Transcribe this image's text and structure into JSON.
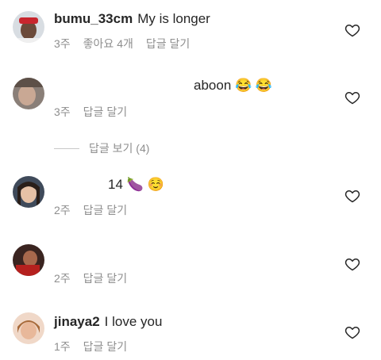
{
  "comments": [
    {
      "username": "bumu_33cm",
      "text": "My is longer",
      "time": "3주",
      "likes": "좋아요 4개",
      "reply": "답글 달기"
    },
    {
      "username": "",
      "text": "aboon 😂 😂",
      "time": "3주",
      "reply": "답글 달기"
    },
    {
      "username": "",
      "text": "14 🍆 ☺️",
      "time": "2주",
      "reply": "답글 달기"
    },
    {
      "username": "",
      "text": "",
      "time": "2주",
      "reply": "답글 달기"
    },
    {
      "username": "jinaya2",
      "text": "I love you",
      "time": "1주",
      "reply": "답글 달기"
    }
  ],
  "view_replies": "답글 보기 (4)",
  "colors": {
    "text": "#262626",
    "meta": "#8e8e8e",
    "heart_outline": "#262626"
  },
  "icons": {
    "like": "heart-outline-icon"
  }
}
